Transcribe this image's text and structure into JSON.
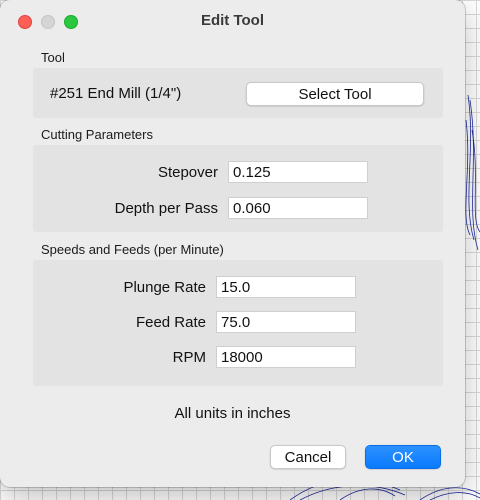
{
  "window": {
    "title": "Edit Tool"
  },
  "tool_section": {
    "label": "Tool",
    "tool_name": "#251 End Mill (1/4\")",
    "select_button": "Select Tool"
  },
  "cutting_section": {
    "label": "Cutting Parameters",
    "stepover_label": "Stepover",
    "stepover_value": "0.125",
    "depth_label": "Depth per Pass",
    "depth_value": "0.060"
  },
  "speeds_section": {
    "label": "Speeds and Feeds (per Minute)",
    "plunge_label": "Plunge Rate",
    "plunge_value": "15.0",
    "feed_label": "Feed Rate",
    "feed_value": "75.0",
    "rpm_label": "RPM",
    "rpm_value": "18000"
  },
  "footer": {
    "units_note": "All units in inches",
    "cancel_button": "Cancel",
    "ok_button": "OK"
  },
  "colors": {
    "accent": "#0a7aff",
    "close": "#fe5f57",
    "maximize": "#2ac840",
    "contour": "#1f2a9e"
  }
}
